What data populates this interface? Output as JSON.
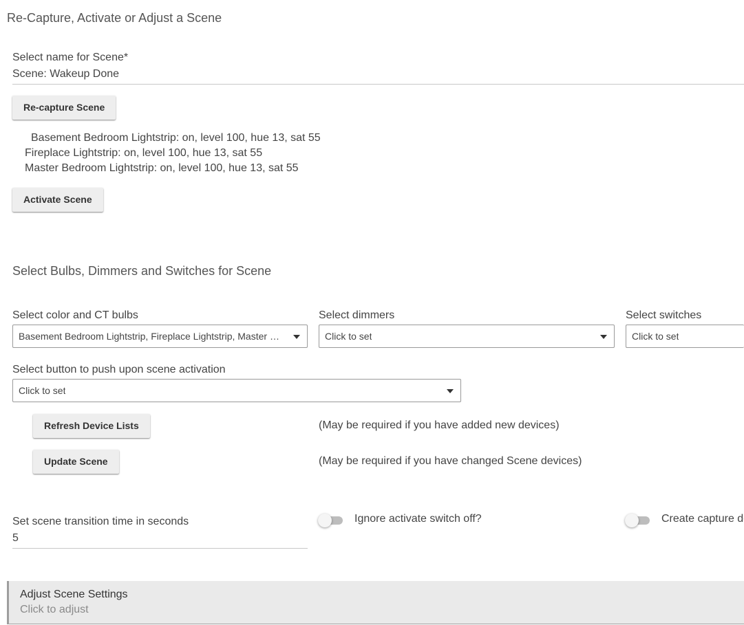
{
  "page": {
    "title": "Re-Capture, Activate or Adjust a Scene"
  },
  "scene_name": {
    "label": "Select name for Scene*",
    "value": "Scene: Wakeup Done"
  },
  "buttons": {
    "recapture": "Re-capture Scene",
    "activate": "Activate Scene",
    "refresh": "Refresh Device Lists",
    "update": "Update Scene"
  },
  "captured_devices": [
    "Basement Bedroom Lightstrip: on, level 100, hue 13, sat 55",
    "Fireplace Lightstrip: on, level 100, hue 13, sat 55",
    "Master Bedroom Lightstrip: on, level 100, hue 13, sat 55"
  ],
  "device_section": {
    "title": "Select Bulbs, Dimmers and Switches for Scene",
    "color_bulbs": {
      "label": "Select color and CT bulbs",
      "value": "Basement Bedroom Lightstrip, Fireplace Lightstrip, Master Bedroom Lightstrip"
    },
    "dimmers": {
      "label": "Select dimmers",
      "value": "Click to set"
    },
    "switches": {
      "label": "Select switches",
      "value": "Click to set"
    },
    "button_push": {
      "label": "Select button to push upon scene activation",
      "value": "Click to set"
    },
    "refresh_note": "(May be required if you have added new devices)",
    "update_note": "(May be required if you have changed Scene devices)"
  },
  "transition": {
    "label": "Set scene transition time in seconds",
    "value": "5"
  },
  "toggles": {
    "ignore_switch_off": {
      "label": "Ignore activate switch off?",
      "checked": false
    },
    "create_capture": {
      "label": "Create capture device?",
      "checked": false
    }
  },
  "adjust": {
    "title": "Adjust Scene Settings",
    "subtitle": "Click to adjust"
  },
  "colors": {
    "button_bg": "#eeeeee",
    "toggle_track": "#bdbdbd",
    "panel_bg": "#eaeaea"
  }
}
